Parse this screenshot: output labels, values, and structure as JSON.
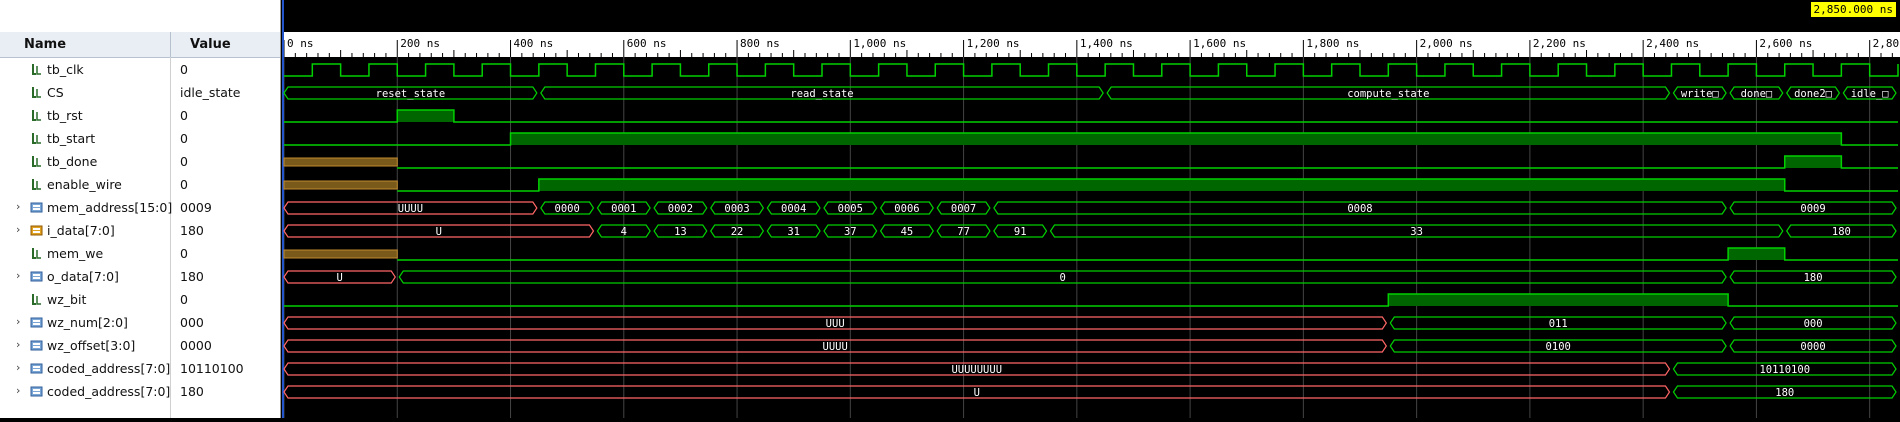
{
  "header": {
    "name_col": "Name",
    "value_col": "Value",
    "cursor_time": "2,850.000 ns"
  },
  "timeline": {
    "max_ns": 2850,
    "tick_labels": [
      {
        "ns": 0,
        "label": "0 ns"
      },
      {
        "ns": 200,
        "label": "200 ns"
      },
      {
        "ns": 400,
        "label": "400 ns"
      },
      {
        "ns": 600,
        "label": "600 ns"
      },
      {
        "ns": 800,
        "label": "800 ns"
      },
      {
        "ns": 1000,
        "label": "1,000 ns"
      },
      {
        "ns": 1200,
        "label": "1,200 ns"
      },
      {
        "ns": 1400,
        "label": "1,400 ns"
      },
      {
        "ns": 1600,
        "label": "1,600 ns"
      },
      {
        "ns": 1800,
        "label": "1,800 ns"
      },
      {
        "ns": 2000,
        "label": "2,000 ns"
      },
      {
        "ns": 2200,
        "label": "2,200 ns"
      },
      {
        "ns": 2400,
        "label": "2,400 ns"
      },
      {
        "ns": 2600,
        "label": "2,600 ns"
      },
      {
        "ns": 2800,
        "label": "2,80"
      }
    ]
  },
  "colors": {
    "wave": "#00d000",
    "fill": "#006600",
    "undefined": "#ff6666",
    "unknown_fill": "#7a5a1a",
    "label": "#ffffff"
  },
  "signals": [
    {
      "name": "tb_clk",
      "value": "0",
      "icon": "bit-icon",
      "expandable": false,
      "type": "clock",
      "period": 100,
      "first_rise": 50
    },
    {
      "name": "CS",
      "value": "idle_state",
      "icon": "bit-icon",
      "expandable": false,
      "type": "bus",
      "segments": [
        {
          "s": 0,
          "e": 450,
          "label": "reset_state"
        },
        {
          "s": 450,
          "e": 1450,
          "label": "read_state"
        },
        {
          "s": 1450,
          "e": 2450,
          "label": "compute_state"
        },
        {
          "s": 2450,
          "e": 2550,
          "label": "write□"
        },
        {
          "s": 2550,
          "e": 2650,
          "label": "done□"
        },
        {
          "s": 2650,
          "e": 2750,
          "label": "done2□"
        },
        {
          "s": 2750,
          "e": 2850,
          "label": "idle_□"
        }
      ]
    },
    {
      "name": "tb_rst",
      "value": "0",
      "icon": "bit-icon",
      "expandable": false,
      "type": "bit",
      "segments": [
        {
          "s": 0,
          "e": 200,
          "v": "0"
        },
        {
          "s": 200,
          "e": 300,
          "v": "1"
        },
        {
          "s": 300,
          "e": 2850,
          "v": "0"
        }
      ]
    },
    {
      "name": "tb_start",
      "value": "0",
      "icon": "bit-icon",
      "expandable": false,
      "type": "bit",
      "segments": [
        {
          "s": 0,
          "e": 400,
          "v": "0"
        },
        {
          "s": 400,
          "e": 2750,
          "v": "1"
        },
        {
          "s": 2750,
          "e": 2850,
          "v": "0"
        }
      ]
    },
    {
      "name": "tb_done",
      "value": "0",
      "icon": "bit-icon",
      "expandable": false,
      "type": "bit",
      "segments": [
        {
          "s": 0,
          "e": 200,
          "v": "X"
        },
        {
          "s": 200,
          "e": 2650,
          "v": "0"
        },
        {
          "s": 2650,
          "e": 2750,
          "v": "1"
        },
        {
          "s": 2750,
          "e": 2850,
          "v": "0"
        }
      ]
    },
    {
      "name": "enable_wire",
      "value": "0",
      "icon": "bit-icon",
      "expandable": false,
      "type": "bit",
      "segments": [
        {
          "s": 0,
          "e": 200,
          "v": "X"
        },
        {
          "s": 200,
          "e": 450,
          "v": "0"
        },
        {
          "s": 450,
          "e": 2650,
          "v": "1"
        },
        {
          "s": 2650,
          "e": 2850,
          "v": "0"
        }
      ]
    },
    {
      "name": "mem_address[15:0]",
      "value": "0009",
      "icon": "bus-icon",
      "expandable": true,
      "type": "bus",
      "segments": [
        {
          "s": 0,
          "e": 450,
          "label": "UUUU",
          "undef": true
        },
        {
          "s": 450,
          "e": 550,
          "label": "0000"
        },
        {
          "s": 550,
          "e": 650,
          "label": "0001"
        },
        {
          "s": 650,
          "e": 750,
          "label": "0002"
        },
        {
          "s": 750,
          "e": 850,
          "label": "0003"
        },
        {
          "s": 850,
          "e": 950,
          "label": "0004"
        },
        {
          "s": 950,
          "e": 1050,
          "label": "0005"
        },
        {
          "s": 1050,
          "e": 1150,
          "label": "0006"
        },
        {
          "s": 1150,
          "e": 1250,
          "label": "0007"
        },
        {
          "s": 1250,
          "e": 2550,
          "label": "0008"
        },
        {
          "s": 2550,
          "e": 2850,
          "label": "0009"
        }
      ]
    },
    {
      "name": "i_data[7:0]",
      "value": "180",
      "icon": "int-icon",
      "expandable": true,
      "type": "bus",
      "segments": [
        {
          "s": 0,
          "e": 550,
          "label": "U",
          "undef": true
        },
        {
          "s": 550,
          "e": 650,
          "label": "4"
        },
        {
          "s": 650,
          "e": 750,
          "label": "13"
        },
        {
          "s": 750,
          "e": 850,
          "label": "22"
        },
        {
          "s": 850,
          "e": 950,
          "label": "31"
        },
        {
          "s": 950,
          "e": 1050,
          "label": "37"
        },
        {
          "s": 1050,
          "e": 1150,
          "label": "45"
        },
        {
          "s": 1150,
          "e": 1250,
          "label": "77"
        },
        {
          "s": 1250,
          "e": 1350,
          "label": "91"
        },
        {
          "s": 1350,
          "e": 2650,
          "label": "33"
        },
        {
          "s": 2650,
          "e": 2850,
          "label": "180"
        }
      ]
    },
    {
      "name": "mem_we",
      "value": "0",
      "icon": "bit-icon",
      "expandable": false,
      "type": "bit",
      "segments": [
        {
          "s": 0,
          "e": 200,
          "v": "X"
        },
        {
          "s": 200,
          "e": 2550,
          "v": "0"
        },
        {
          "s": 2550,
          "e": 2650,
          "v": "1"
        },
        {
          "s": 2650,
          "e": 2850,
          "v": "0"
        }
      ]
    },
    {
      "name": "o_data[7:0]",
      "value": "180",
      "icon": "bus-icon",
      "expandable": true,
      "type": "bus",
      "segments": [
        {
          "s": 0,
          "e": 200,
          "label": "U",
          "undef": true
        },
        {
          "s": 200,
          "e": 2550,
          "label": "0"
        },
        {
          "s": 2550,
          "e": 2850,
          "label": "180"
        }
      ]
    },
    {
      "name": "wz_bit",
      "value": "0",
      "icon": "bit-icon",
      "expandable": false,
      "type": "bit",
      "segments": [
        {
          "s": 0,
          "e": 1950,
          "v": "0"
        },
        {
          "s": 1950,
          "e": 2550,
          "v": "1"
        },
        {
          "s": 2550,
          "e": 2850,
          "v": "0"
        }
      ]
    },
    {
      "name": "wz_num[2:0]",
      "value": "000",
      "icon": "bus-icon",
      "expandable": true,
      "type": "bus",
      "segments": [
        {
          "s": 0,
          "e": 1950,
          "label": "UUU",
          "undef": true
        },
        {
          "s": 1950,
          "e": 2550,
          "label": "011"
        },
        {
          "s": 2550,
          "e": 2850,
          "label": "000"
        }
      ]
    },
    {
      "name": "wz_offset[3:0]",
      "value": "0000",
      "icon": "bus-icon",
      "expandable": true,
      "type": "bus",
      "segments": [
        {
          "s": 0,
          "e": 1950,
          "label": "UUUU",
          "undef": true
        },
        {
          "s": 1950,
          "e": 2550,
          "label": "0100"
        },
        {
          "s": 2550,
          "e": 2850,
          "label": "0000"
        }
      ]
    },
    {
      "name": "coded_address[7:0]",
      "value": "10110100",
      "icon": "bus-icon",
      "expandable": true,
      "type": "bus",
      "segments": [
        {
          "s": 0,
          "e": 2450,
          "label": "UUUUUUUU",
          "undef": true
        },
        {
          "s": 2450,
          "e": 2850,
          "label": "10110100"
        }
      ]
    },
    {
      "name": "coded_address[7:0]",
      "value": "180",
      "icon": "bus-icon",
      "expandable": true,
      "type": "bus",
      "segments": [
        {
          "s": 0,
          "e": 2450,
          "label": "U",
          "undef": true
        },
        {
          "s": 2450,
          "e": 2850,
          "label": "180"
        }
      ]
    }
  ]
}
